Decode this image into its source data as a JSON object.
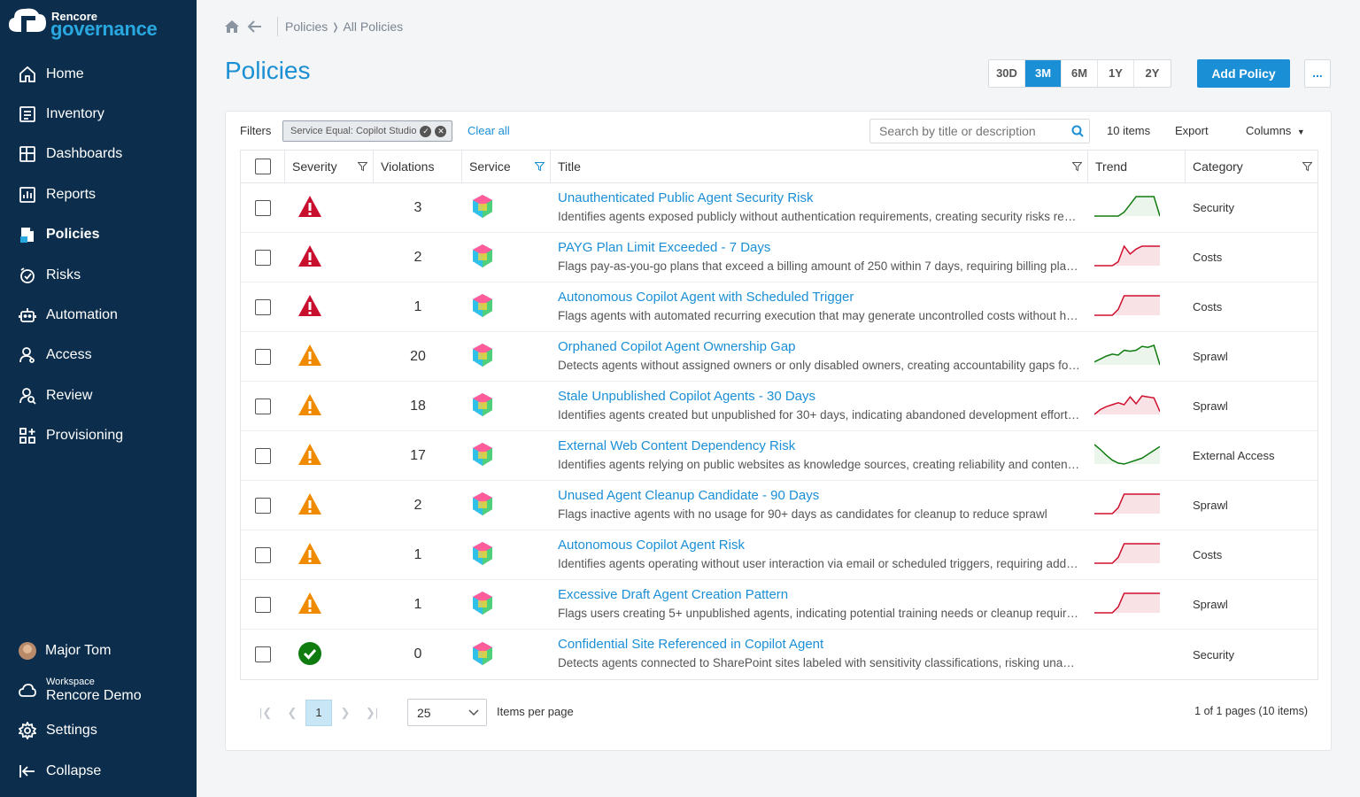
{
  "sidebar": {
    "brand": "Rencore",
    "product": "governance",
    "items": [
      {
        "label": "Home",
        "icon": "home-icon"
      },
      {
        "label": "Inventory",
        "icon": "inventory-icon"
      },
      {
        "label": "Dashboards",
        "icon": "dashboards-icon"
      },
      {
        "label": "Reports",
        "icon": "reports-icon"
      },
      {
        "label": "Policies",
        "icon": "policies-icon",
        "active": true
      },
      {
        "label": "Risks",
        "icon": "risks-icon"
      },
      {
        "label": "Automation",
        "icon": "robot-icon"
      },
      {
        "label": "Access",
        "icon": "user-icon"
      },
      {
        "label": "Review",
        "icon": "review-icon"
      },
      {
        "label": "Provisioning",
        "icon": "provisioning-icon"
      }
    ],
    "user": "Major Tom",
    "workspace_label": "Workspace",
    "workspace_name": "Rencore Demo",
    "settings": "Settings",
    "collapse": "Collapse"
  },
  "breadcrumb": {
    "parent": "Policies",
    "separator": "❭",
    "current": "All Policies"
  },
  "page_title": "Policies",
  "range_options": [
    "30D",
    "3M",
    "6M",
    "1Y",
    "2Y"
  ],
  "range_selected": "3M",
  "add_button": "Add Policy",
  "more_button": "...",
  "toolbar": {
    "filters_label": "Filters",
    "chip": "Service Equal: Copilot Studio",
    "clear_all": "Clear all",
    "search_placeholder": "Search by title or description",
    "item_count": "10 items",
    "export": "Export",
    "columns": "Columns"
  },
  "columns": [
    "Severity",
    "Violations",
    "Service",
    "Title",
    "Trend",
    "Category"
  ],
  "colors": {
    "accent": "#1b8fd6",
    "critical": "#c8102e",
    "warning": "#f08a00",
    "ok": "#107c10",
    "sidebar": "#0c2e4c"
  },
  "rows": [
    {
      "severity": "critical",
      "violations": "3",
      "title": "Unauthenticated Public Agent Security Risk",
      "description": "Identifies agents exposed publicly without authentication requirements, creating security risks req…",
      "category": "Security",
      "trend_color": "green",
      "trend": [
        0,
        0,
        0,
        0,
        0,
        0.2,
        0.6,
        1,
        1,
        1,
        1,
        0
      ]
    },
    {
      "severity": "critical",
      "violations": "2",
      "title": "PAYG Plan Limit Exceeded - 7 Days",
      "description": "Flags pay-as-you-go plans that exceed a billing amount of 250 within 7 days, requiring billing plan r…",
      "category": "Costs",
      "trend_color": "red",
      "trend": [
        0,
        0,
        0,
        0,
        0.2,
        1,
        0.6,
        0.85,
        1,
        1,
        1,
        1
      ]
    },
    {
      "severity": "critical",
      "violations": "1",
      "title": "Autonomous Copilot Agent with Scheduled Trigger",
      "description": "Flags agents with automated recurring execution that may generate uncontrolled costs without hu…",
      "category": "Costs",
      "trend_color": "red",
      "trend": [
        0,
        0,
        0,
        0,
        0.3,
        1,
        1,
        1,
        1,
        1,
        1,
        1
      ]
    },
    {
      "severity": "warning",
      "violations": "20",
      "title": "Orphaned Copilot Agent Ownership Gap",
      "description": "Detects agents without assigned owners or only disabled owners, creating accountability gaps for …",
      "category": "Sprawl",
      "trend_color": "green",
      "trend": [
        0.15,
        0.3,
        0.45,
        0.55,
        0.5,
        0.75,
        0.7,
        0.75,
        0.95,
        0.9,
        1,
        0
      ]
    },
    {
      "severity": "warning",
      "violations": "18",
      "title": "Stale Unpublished Copilot Agents - 30 Days",
      "description": "Identifies agents created but unpublished for 30+ days, indicating abandoned development efforts …",
      "category": "Sprawl",
      "trend_color": "red",
      "trend": [
        0,
        0.25,
        0.4,
        0.5,
        0.6,
        0.5,
        0.9,
        0.55,
        0.95,
        0.9,
        0.85,
        0.15
      ]
    },
    {
      "severity": "warning",
      "violations": "17",
      "title": "External Web Content Dependency Risk",
      "description": "Identifies agents relying on public websites as knowledge sources, creating reliability and content c…",
      "category": "External Access",
      "trend_color": "green",
      "trend": [
        1,
        0.75,
        0.45,
        0.2,
        0.05,
        0,
        0.1,
        0.2,
        0.3,
        0.5,
        0.7,
        0.9
      ]
    },
    {
      "severity": "warning",
      "violations": "2",
      "title": "Unused Agent Cleanup Candidate - 90 Days",
      "description": "Flags inactive agents with no usage for 90+ days as candidates for cleanup to reduce sprawl",
      "category": "Sprawl",
      "trend_color": "red",
      "trend": [
        0,
        0,
        0,
        0,
        0.3,
        1,
        1,
        1,
        1,
        1,
        1,
        1
      ]
    },
    {
      "severity": "warning",
      "violations": "1",
      "title": "Autonomous Copilot Agent Risk",
      "description": "Identifies agents operating without user interaction via email or scheduled triggers, requiring addit…",
      "category": "Costs",
      "trend_color": "red",
      "trend": [
        0,
        0,
        0,
        0,
        0.3,
        1,
        1,
        1,
        1,
        1,
        1,
        1
      ]
    },
    {
      "severity": "warning",
      "violations": "1",
      "title": "Excessive Draft Agent Creation Pattern",
      "description": "Flags users creating 5+ unpublished agents, indicating potential training needs or cleanup require…",
      "category": "Sprawl",
      "trend_color": "red",
      "trend": [
        0,
        0,
        0,
        0,
        0.3,
        1,
        1,
        1,
        1,
        1,
        1,
        1
      ]
    },
    {
      "severity": "ok",
      "violations": "0",
      "title": "Confidential Site Referenced in Copilot Agent",
      "description": "Detects agents connected to SharePoint sites labeled with sensitivity classifications, risking unauth…",
      "category": "Security",
      "trend_color": "none",
      "trend": []
    }
  ],
  "pagination": {
    "current_page": "1",
    "page_size": "25",
    "items_per_page_label": "Items per page",
    "summary": "1 of 1 pages (10 items)"
  }
}
